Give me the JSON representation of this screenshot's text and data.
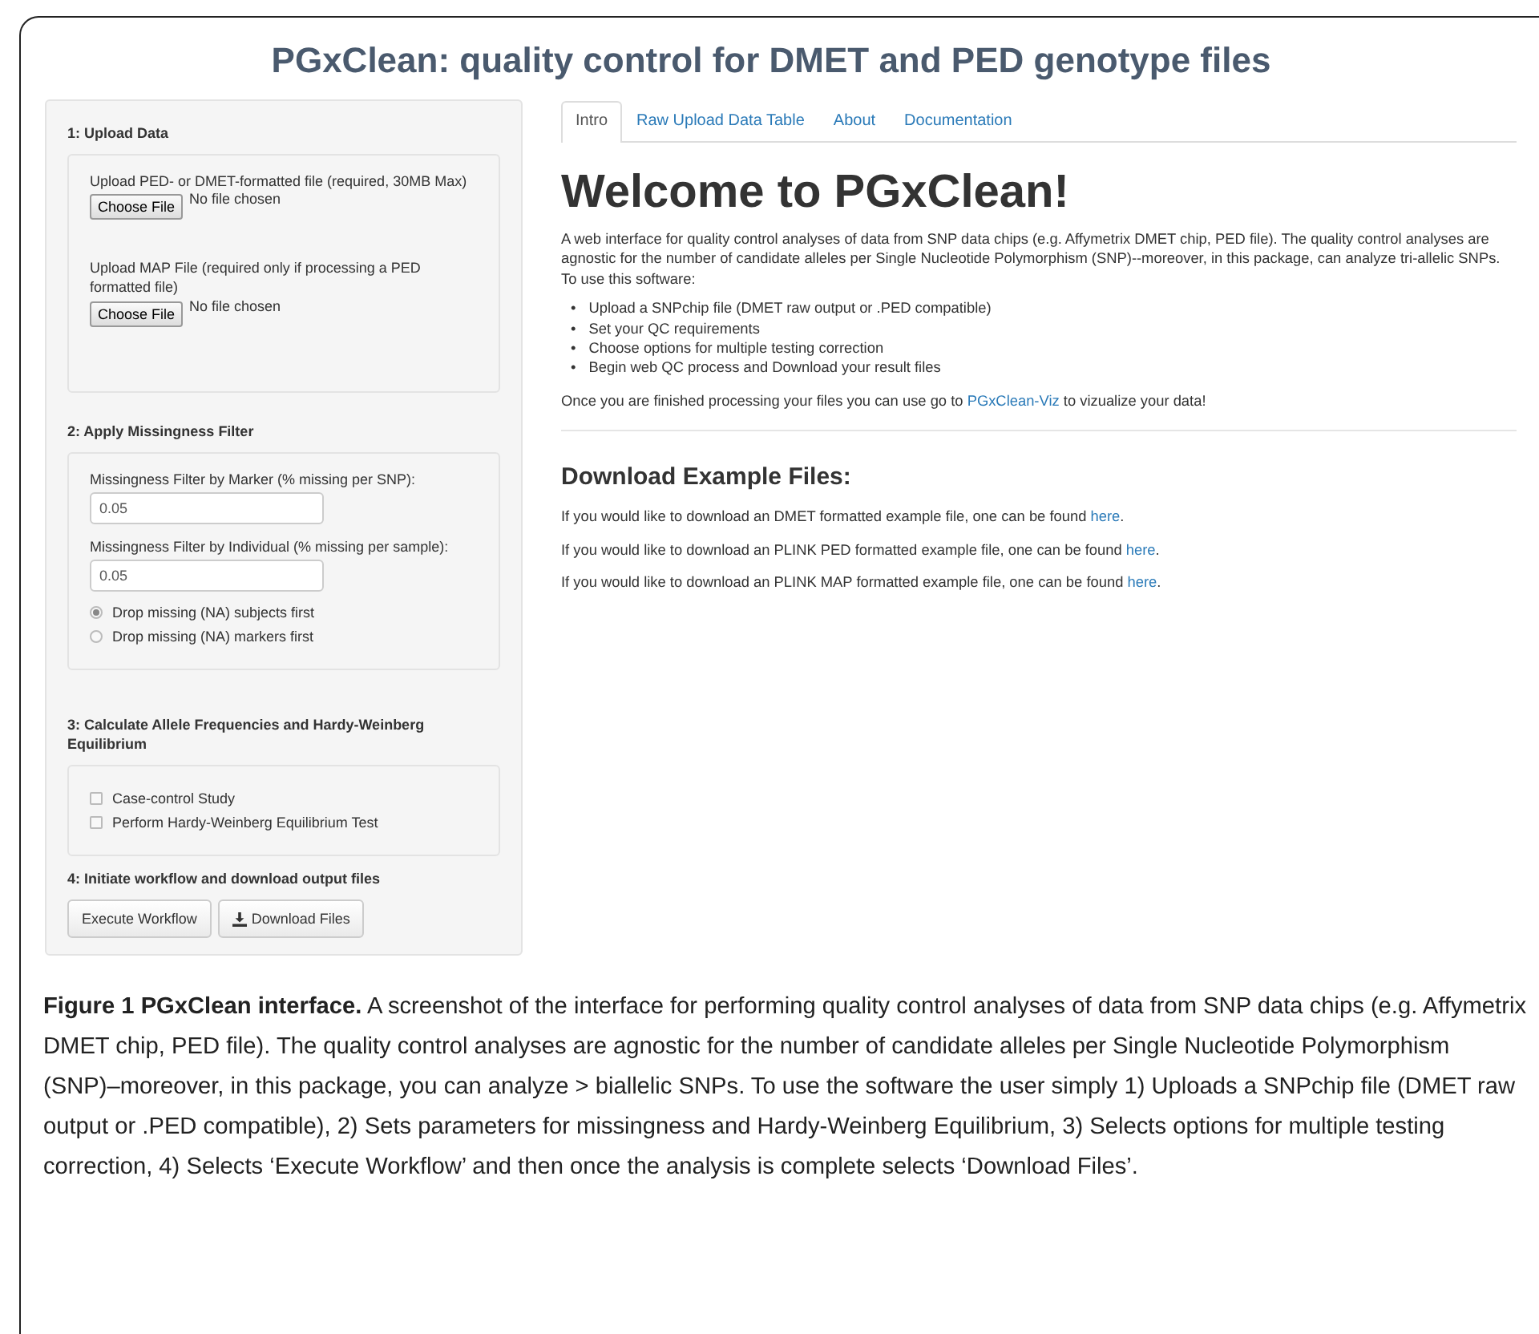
{
  "title": "PGxClean: quality control for DMET and PED genotype files",
  "sidebar": {
    "sections": [
      {
        "kind": "upload",
        "heading": "1: Upload Data",
        "fields": [
          {
            "label": "Upload PED- or DMET-formatted file (required, 30MB Max)",
            "button": "Choose File",
            "status": "No file chosen"
          },
          {
            "label": "Upload MAP File (required only if processing a PED formatted file)",
            "button": "Choose File",
            "status": "No file chosen"
          }
        ]
      },
      {
        "kind": "filter",
        "heading": "2: Apply Missingness Filter",
        "inputs": [
          {
            "label": "Missingness Filter by Marker (% missing per SNP):",
            "value": "0.05"
          },
          {
            "label": "Missingness Filter by Individual (% missing per sample):",
            "value": "0.05"
          }
        ],
        "radios": [
          {
            "label": "Drop missing (NA) subjects first",
            "selected": true
          },
          {
            "label": "Drop missing (NA) markers first",
            "selected": false
          }
        ]
      },
      {
        "kind": "checks",
        "heading": "3: Calculate Allele Frequencies and Hardy-Weinberg Equilibrium",
        "checkboxes": [
          {
            "label": "Case-control Study",
            "checked": false
          },
          {
            "label": "Perform Hardy-Weinberg Equilibrium Test",
            "checked": false
          }
        ]
      },
      {
        "kind": "actions",
        "heading": "4: Initiate workflow and download output files",
        "buttons": [
          {
            "label": "Execute Workflow",
            "kind": "plain"
          },
          {
            "label": "Download Files",
            "kind": "download"
          }
        ]
      }
    ]
  },
  "main": {
    "tabs": [
      {
        "label": "Intro",
        "selected": true
      },
      {
        "label": "Raw Upload Data Table",
        "selected": false
      },
      {
        "label": "About",
        "selected": false
      },
      {
        "label": "Documentation",
        "selected": false
      }
    ],
    "heading": "Welcome to PGxClean!",
    "intro": "A web interface for quality control analyses of data from SNP data chips (e.g. Affymetrix DMET chip, PED file). The quality control analyses are agnostic for the number of candidate alleles per Single Nucleotide Polymorphism (SNP)--moreover, in this package, can analyze tri-allelic SNPs. To use this software:",
    "bullets": [
      {
        "marker": "•",
        "text": "Upload a SNPchip file (DMET raw output or .PED compatible)"
      },
      {
        "marker": "•",
        "text": "Set your QC requirements"
      },
      {
        "marker": "•",
        "text": "Choose options for multiple testing correction"
      },
      {
        "marker": "•",
        "text": "Begin web QC process and Download your result files"
      }
    ],
    "closing": {
      "before": "Once you are finished processing your files you can use go to",
      "link": "PGxClean-Viz",
      "after": "to vizualize your data!"
    },
    "downloads_heading": "Download Example Files:",
    "downloads": [
      {
        "before": "If you would like to download an DMET formatted example file, one can be found",
        "link": "here",
        "after": "."
      },
      {
        "before": "If you would like to download an PLINK PED formatted example file, one can be found",
        "link": "here",
        "after": "."
      },
      {
        "before": "If you would like to download an PLINK MAP formatted example file, one can be found",
        "link": "here",
        "after": "."
      }
    ]
  },
  "caption": "**Figure 1 PGxClean interface.** A screenshot of the interface for performing quality control analyses of data from SNP data chips (e.g. Affymetrix DMET chip, PED file). The quality control analyses are agnostic for the number of candidate alleles per Single Nucleotide Polymorphism (SNP)–moreover, in this package, you can analyze > biallelic SNPs. To use the software the user simply 1) Uploads a SNPchip file (DMET raw output or .PED compatible), 2) Sets parameters for missingness and Hardy-Weinberg Equilibrium, 3) Selects options for multiple testing correction, 4) Selects ‘Execute Workflow’ and then once the analysis is complete selects ‘Download Files’."
}
